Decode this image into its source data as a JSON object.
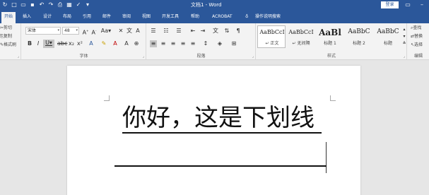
{
  "titlebar": {
    "doc_title": "文档1 - Word",
    "login": "登录"
  },
  "tabs": [
    "开始",
    "插入",
    "设计",
    "布局",
    "引用",
    "邮件",
    "审阅",
    "视图",
    "开发工具",
    "帮助",
    "ACROBAT",
    "操作说明搜索"
  ],
  "ribbon": {
    "clipboard": {
      "cut": "剪切",
      "copy": "复制",
      "format_painter": "格式刷",
      "label": ""
    },
    "font": {
      "font_name": "宋体",
      "font_size": "48",
      "label": "字体"
    },
    "paragraph": {
      "label": "段落"
    },
    "styles": {
      "label": "样式",
      "items": [
        {
          "preview": "AaBbCcI",
          "name": "↵ 正文"
        },
        {
          "preview": "AaBbCcI",
          "name": "↵ 无间隔"
        },
        {
          "preview": "AaBl",
          "name": "标题 1"
        },
        {
          "preview": "AaBbC",
          "name": "标题 2"
        },
        {
          "preview": "AaBbC",
          "name": "标题"
        }
      ]
    },
    "editing": {
      "find": "查找",
      "replace": "替换",
      "select": "选择",
      "label": "编辑"
    }
  },
  "document": {
    "text": "你好，这是下划线"
  }
}
